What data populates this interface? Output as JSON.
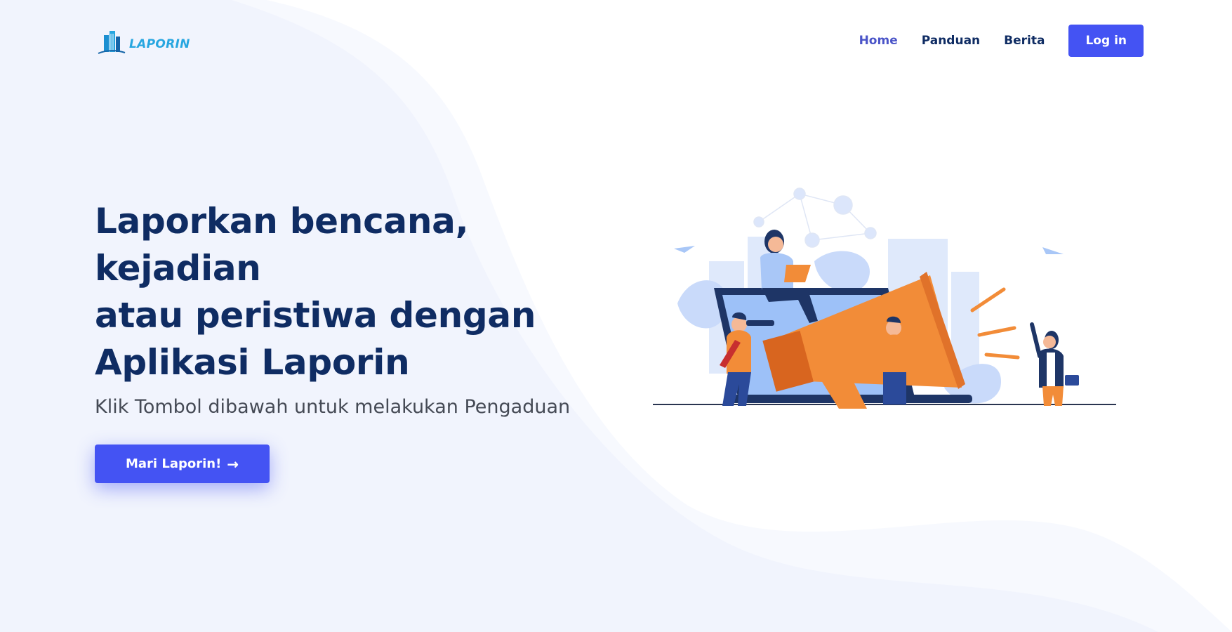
{
  "header": {
    "logo_text": "LAPORIN",
    "nav": {
      "home": "Home",
      "panduan": "Panduan",
      "berita": "Berita",
      "login": "Log in"
    }
  },
  "hero": {
    "title_line1": "Laporkan bencana, kejadian",
    "title_line2": "atau peristiwa dengan",
    "title_line3": "Aplikasi Laporin",
    "subtitle": "Klik Tombol dibawah untuk melakukan Pengaduan",
    "cta_label": "Mari Laporin!",
    "cta_arrow": "→"
  },
  "colors": {
    "primary": "#4453f3",
    "heading": "#0f2c63",
    "nav_active": "#4a54c8",
    "background_wave": "#f1f4fd",
    "logo": "#27a6e0",
    "illustration_orange": "#f28c38",
    "illustration_blue": "#a9c7f7"
  },
  "icons": {
    "logo": "building-logo-icon",
    "cta": "arrow-right-icon"
  }
}
